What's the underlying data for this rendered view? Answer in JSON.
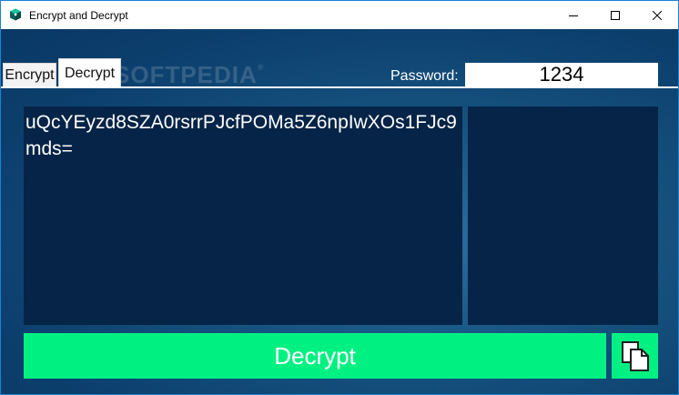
{
  "window": {
    "title": "Encrypt and Decrypt",
    "icon": "app-icon",
    "controls": [
      "minimize-icon",
      "maximize-icon",
      "close-icon"
    ]
  },
  "tabs": [
    {
      "label": "Encrypt",
      "active": false
    },
    {
      "label": "Decrypt",
      "active": true
    }
  ],
  "watermark": {
    "text": "SOFTPEDIA",
    "mark": "®"
  },
  "password": {
    "label": "Password:",
    "value": "1234"
  },
  "output": {
    "text": "uQcYEyzd8SZA0rsrrPJcfPOMa5Z6npIwXOs1FJc9mds="
  },
  "actions": {
    "decrypt_label": "Decrypt",
    "copy_icon": "copy-icon"
  },
  "colors": {
    "accent": "#00f182",
    "panel": "#062447",
    "background": "#0c3f6d",
    "window_border": "#1883d7"
  }
}
